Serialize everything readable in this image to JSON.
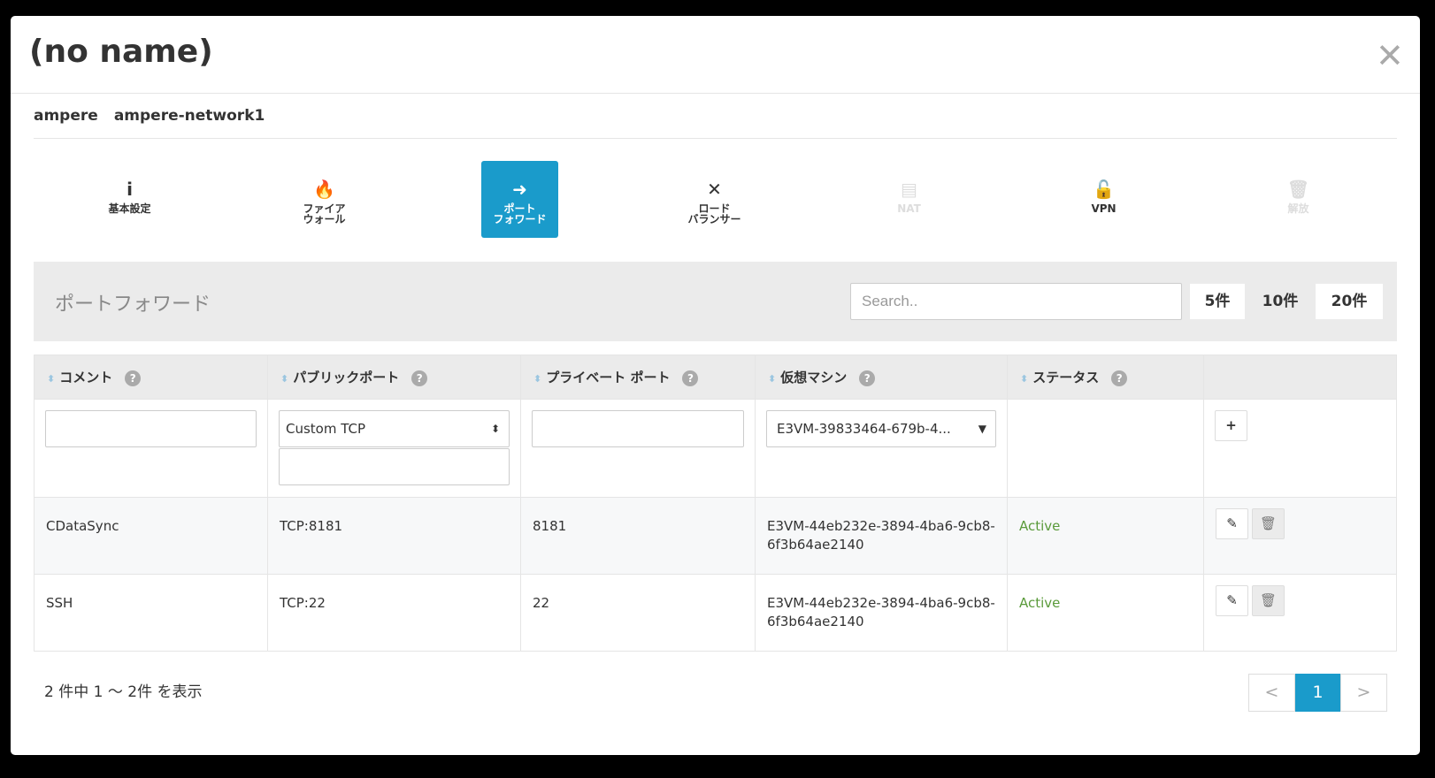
{
  "dialog": {
    "title": "(no name)",
    "close_icon": "close-icon"
  },
  "breadcrumb": [
    "ampere",
    "ampere-network1"
  ],
  "tabs": [
    {
      "label1": "基本設定",
      "label2": "",
      "icon": "i",
      "state": "normal"
    },
    {
      "label1": "ファイア",
      "label2": "ウォール",
      "icon": "🔥",
      "state": "normal"
    },
    {
      "label1": "ポート",
      "label2": "フォワード",
      "icon": "➜",
      "state": "active"
    },
    {
      "label1": "ロード",
      "label2": "バランサー",
      "icon": "✕",
      "state": "normal"
    },
    {
      "label1": "NAT",
      "label2": "",
      "icon": "▤",
      "state": "disabled"
    },
    {
      "label1": "VPN",
      "label2": "",
      "icon": "🔓",
      "state": "normal"
    },
    {
      "label1": "解放",
      "label2": "",
      "icon": "🗑",
      "state": "disabled"
    }
  ],
  "panel": {
    "title": "ポートフォワード",
    "search_placeholder": "Search..",
    "page_sizes": [
      "5件",
      "10件",
      "20件"
    ],
    "selected_page_size": "10件"
  },
  "table": {
    "headers": [
      "コメント",
      "パブリックポート",
      "プライベート ポート",
      "仮想マシン",
      "ステータス"
    ],
    "filter": {
      "comment": "",
      "public_port_type": "Custom TCP",
      "public_port": "",
      "private_port": "",
      "vm": "E3VM-39833464-679b-4..."
    },
    "rows": [
      {
        "comment": "CDataSync",
        "public_port": "TCP:8181",
        "private_port": "8181",
        "vm": "E3VM-44eb232e-3894-4ba6-9cb8-6f3b64ae2140",
        "status": "Active"
      },
      {
        "comment": "SSH",
        "public_port": "TCP:22",
        "private_port": "22",
        "vm": "E3VM-44eb232e-3894-4ba6-9cb8-6f3b64ae2140",
        "status": "Active"
      }
    ]
  },
  "footer": {
    "summary": "2 件中 1 ～ 2件 を表示",
    "prev": "<",
    "page": "1",
    "next": ">"
  },
  "colors": {
    "accent": "#1a9bcb",
    "active": "#5a9a3a"
  }
}
